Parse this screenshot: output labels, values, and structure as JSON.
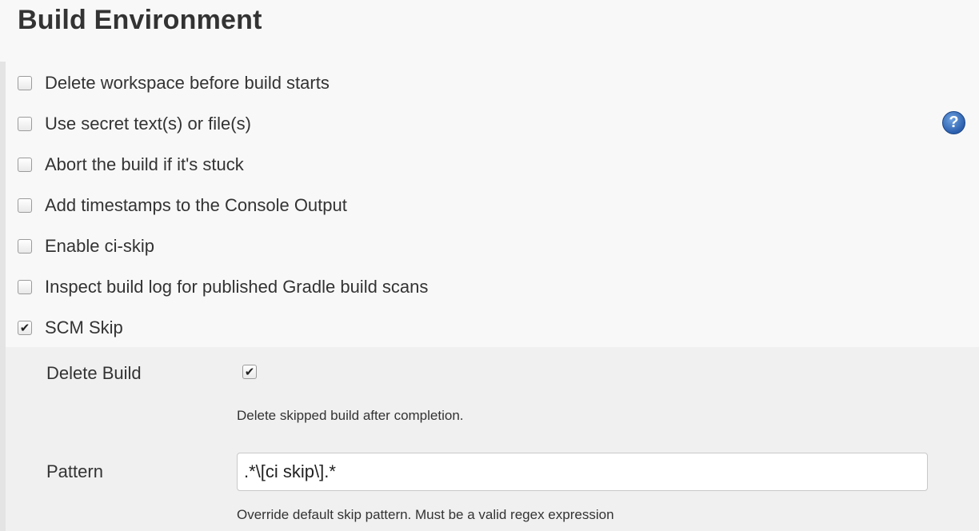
{
  "section": {
    "title": "Build Environment"
  },
  "options": [
    {
      "label": "Delete workspace before build starts",
      "checked": false
    },
    {
      "label": "Use secret text(s) or file(s)",
      "checked": false,
      "help": true
    },
    {
      "label": "Abort the build if it's stuck",
      "checked": false
    },
    {
      "label": "Add timestamps to the Console Output",
      "checked": false
    },
    {
      "label": "Enable ci-skip",
      "checked": false
    },
    {
      "label": "Inspect build log for published Gradle build scans",
      "checked": false
    },
    {
      "label": "SCM Skip",
      "checked": true
    }
  ],
  "help_icon": {
    "glyph": "?",
    "icon": "help-icon",
    "color": "#2b5fae"
  },
  "scm_skip": {
    "delete_build": {
      "label": "Delete Build",
      "checked": true,
      "description": "Delete skipped build after completion."
    },
    "pattern": {
      "label": "Pattern",
      "value": ".*\\[ci skip\\].*",
      "description": "Override default skip pattern. Must be a valid regex expression"
    }
  },
  "check_glyph": "✔"
}
